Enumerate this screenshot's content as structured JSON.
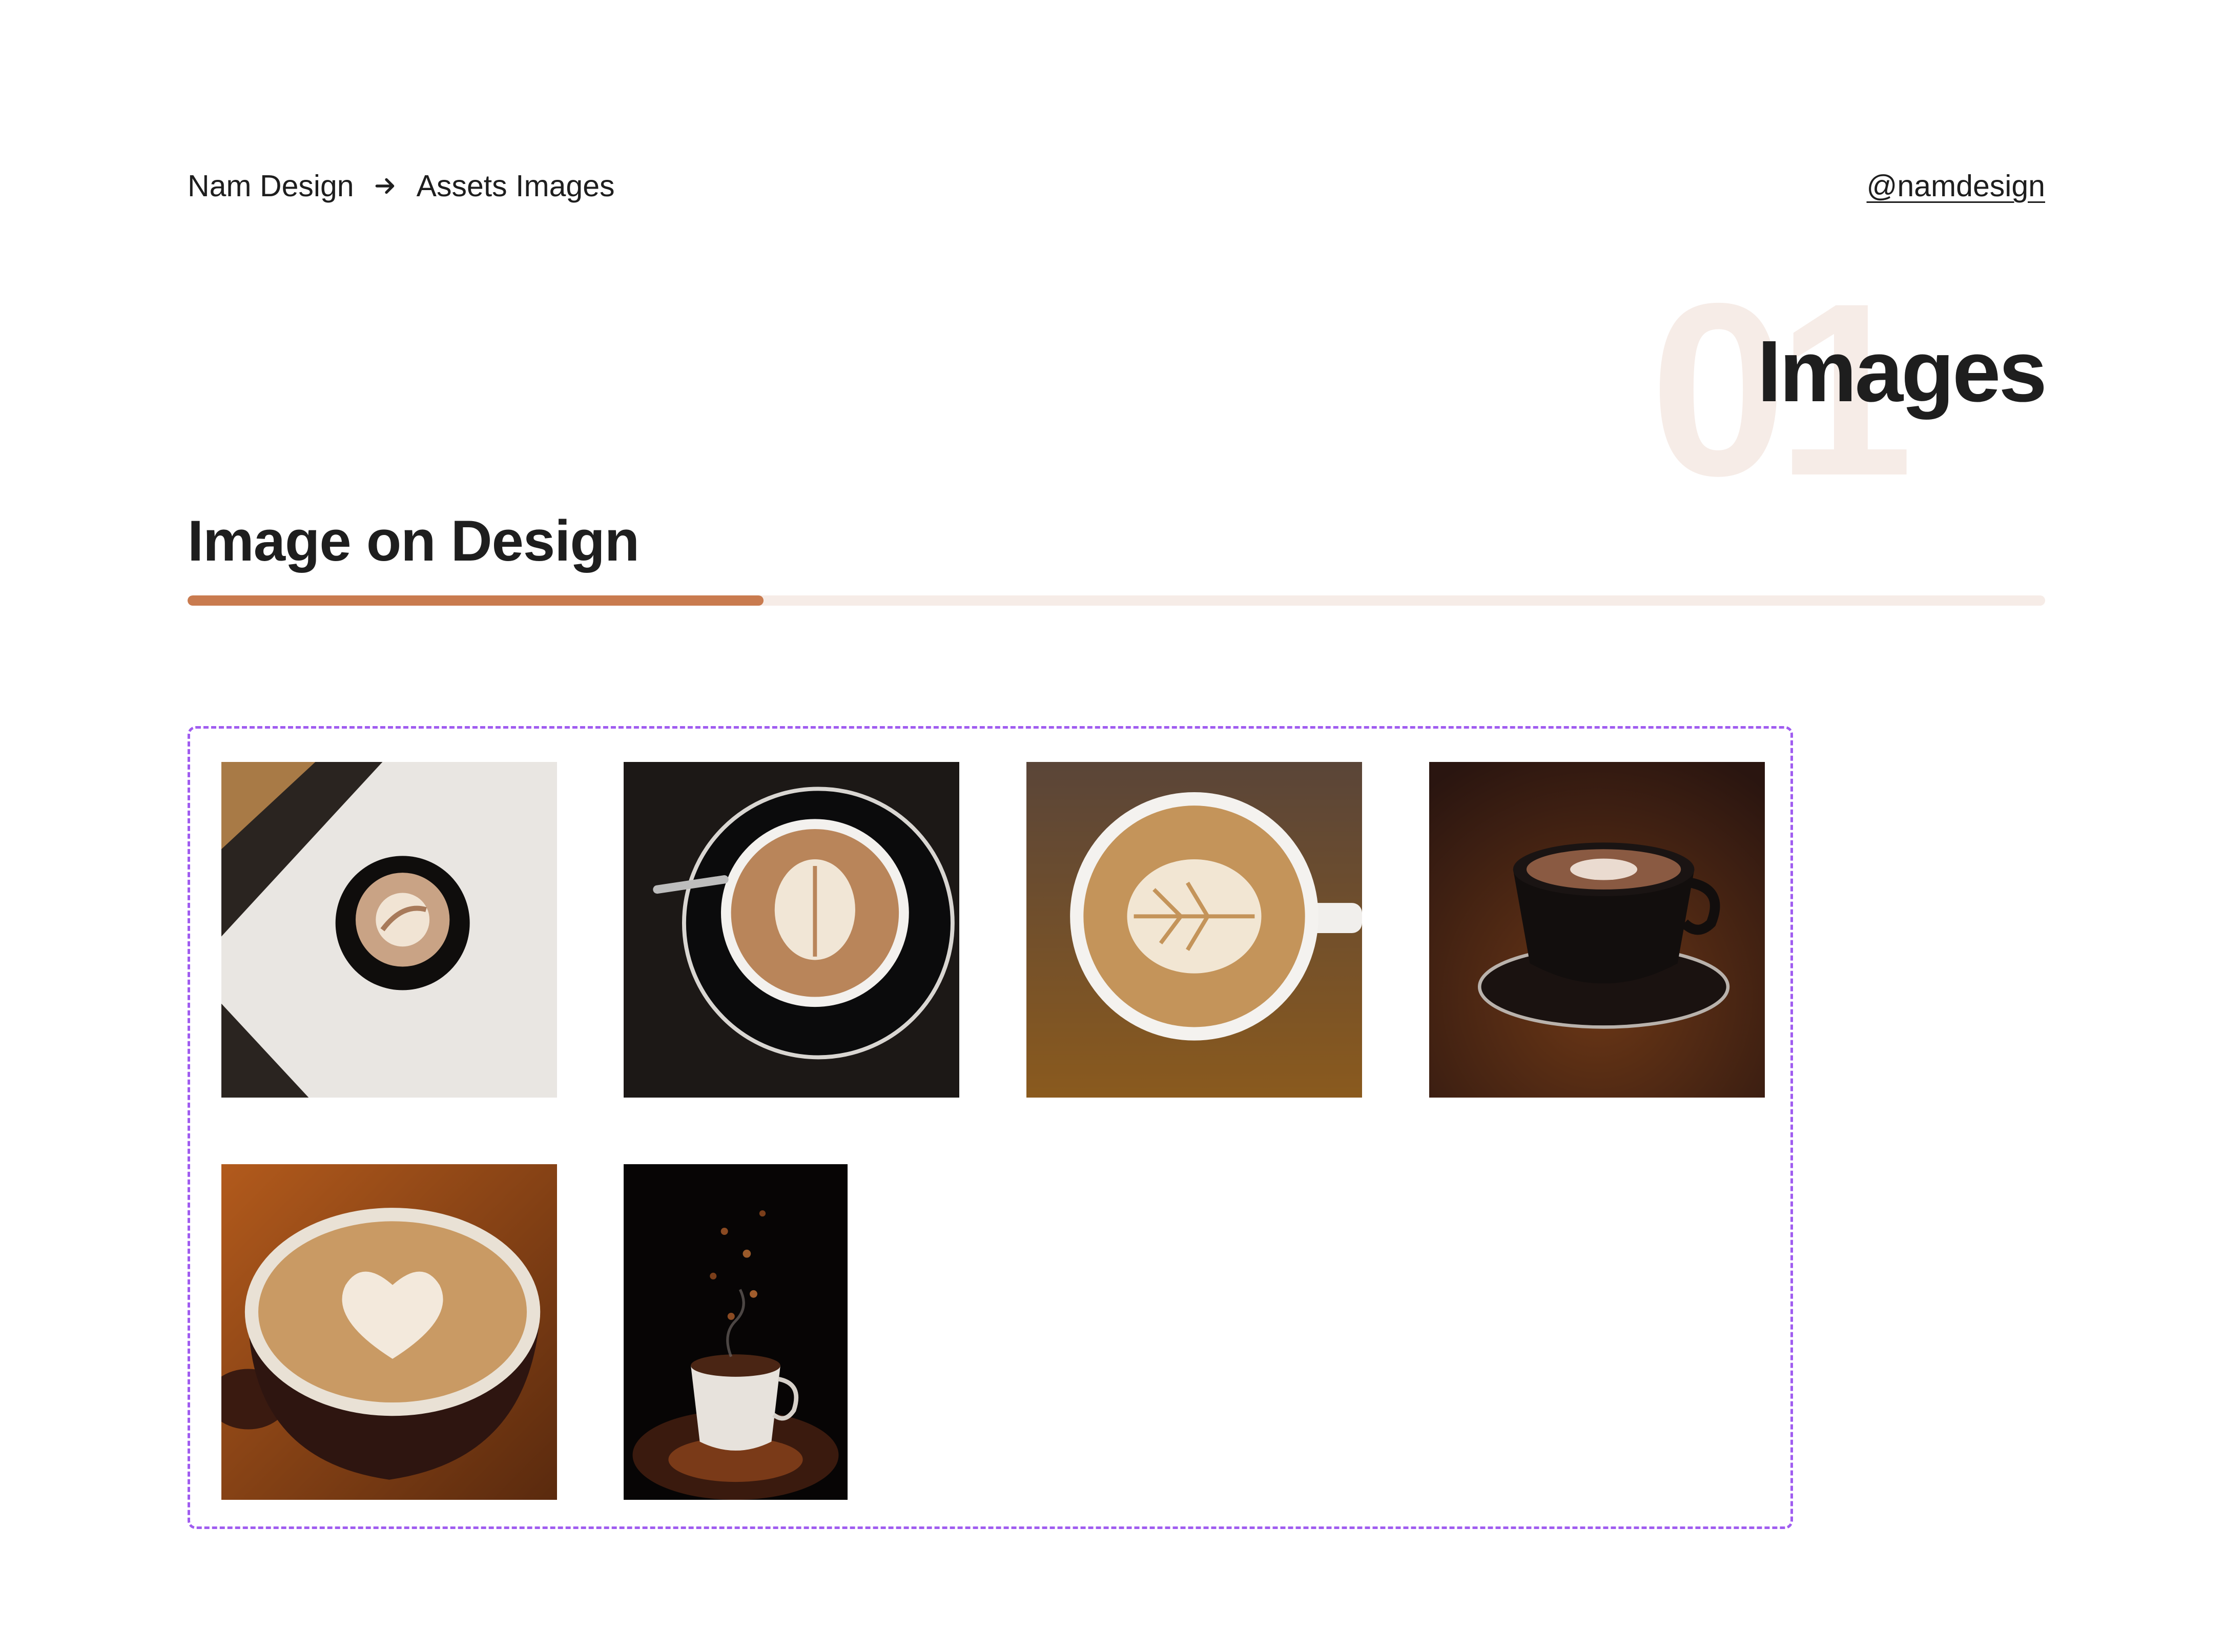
{
  "breadcrumb": {
    "home": "Nam Design",
    "current": "Assets Images"
  },
  "handle": "@namdesign",
  "section": {
    "number": "01",
    "title": "Images"
  },
  "subsection": {
    "title": "Image on Design",
    "progress": 0.31
  },
  "colors": {
    "accent": "#c97b4f",
    "track": "#f6ece7",
    "frame": "#a05cf0"
  },
  "gallery": {
    "items": [
      {
        "icon": "latte-art-photo"
      },
      {
        "icon": "latte-art-photo"
      },
      {
        "icon": "latte-art-photo"
      },
      {
        "icon": "coffee-cup-photo"
      },
      {
        "icon": "latte-art-photo"
      },
      {
        "icon": "coffee-beans-cup-photo"
      }
    ]
  }
}
